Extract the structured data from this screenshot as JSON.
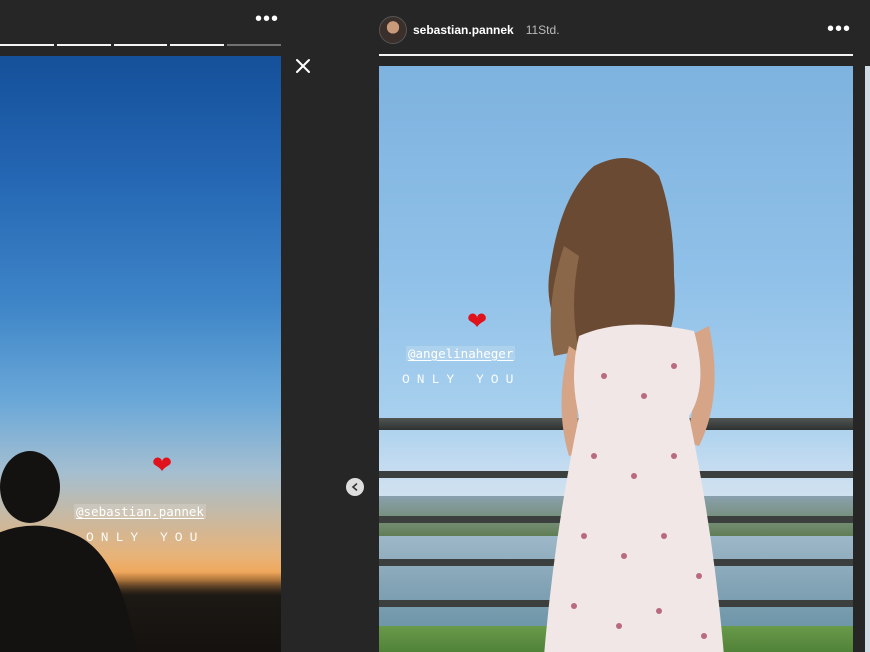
{
  "left_story": {
    "mention": "@sebastian.pannek",
    "caption": "ONLY YOU",
    "heart": "❤",
    "progress_segments": 5,
    "more_icon": "more-horizontal-icon"
  },
  "controls": {
    "close_icon": "close-icon",
    "prev_icon": "chevron-left-icon"
  },
  "main_story": {
    "username": "sebastian.pannek",
    "timestamp": "11Std.",
    "mention": "@angelinaheger",
    "caption": "ONLY YOU",
    "heart": "❤",
    "more_icon": "more-horizontal-icon",
    "progress_segments": 1
  },
  "colors": {
    "background": "#262626",
    "heart": "#e0131d",
    "text": "#ffffff",
    "timestamp": "#bbbbbb"
  }
}
